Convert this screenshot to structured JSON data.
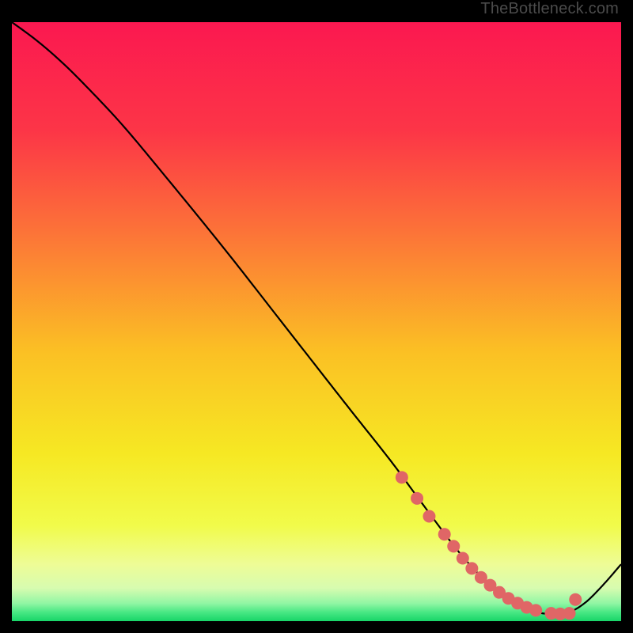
{
  "watermark": "TheBottleneck.com",
  "colors": {
    "frame": "#000000",
    "curve": "#000000",
    "marker_fill": "#e06666",
    "marker_stroke": "#c45555"
  },
  "chart_data": {
    "type": "line",
    "title": "",
    "xlabel": "",
    "ylabel": "",
    "xlim": [
      0,
      100
    ],
    "ylim": [
      0,
      100
    ],
    "gradient_stops": [
      {
        "offset": 0.0,
        "color": "#fb1850"
      },
      {
        "offset": 0.18,
        "color": "#fc3547"
      },
      {
        "offset": 0.35,
        "color": "#fc7338"
      },
      {
        "offset": 0.55,
        "color": "#fbc024"
      },
      {
        "offset": 0.72,
        "color": "#f6e823"
      },
      {
        "offset": 0.84,
        "color": "#f1fb4a"
      },
      {
        "offset": 0.905,
        "color": "#eefc96"
      },
      {
        "offset": 0.945,
        "color": "#d7fcb0"
      },
      {
        "offset": 0.97,
        "color": "#92f6a4"
      },
      {
        "offset": 0.985,
        "color": "#49e884"
      },
      {
        "offset": 1.0,
        "color": "#18d568"
      }
    ],
    "series": [
      {
        "name": "bottleneck-curve",
        "x": [
          0,
          4,
          8,
          12,
          18,
          25,
          35,
          45,
          55,
          62,
          66,
          70,
          73,
          76,
          79,
          82,
          85,
          88,
          91,
          94,
          97,
          100
        ],
        "y": [
          100,
          97,
          93.5,
          89.5,
          83,
          74.5,
          62,
          49,
          36,
          27,
          21.5,
          16,
          12,
          8.5,
          5.5,
          3.3,
          1.8,
          1.2,
          1.3,
          3.0,
          6.0,
          9.5
        ]
      }
    ],
    "markers": {
      "name": "highlighted-points",
      "x": [
        64.0,
        66.5,
        68.5,
        71.0,
        72.5,
        74.0,
        75.5,
        77.0,
        78.5,
        80.0,
        81.5,
        83.0,
        84.5,
        86.0,
        88.5,
        90.0,
        91.5,
        92.5
      ],
      "y": [
        24.0,
        20.5,
        17.5,
        14.5,
        12.5,
        10.5,
        8.8,
        7.3,
        6.0,
        4.8,
        3.8,
        3.0,
        2.3,
        1.8,
        1.3,
        1.2,
        1.3,
        3.6
      ],
      "r": 8
    }
  }
}
